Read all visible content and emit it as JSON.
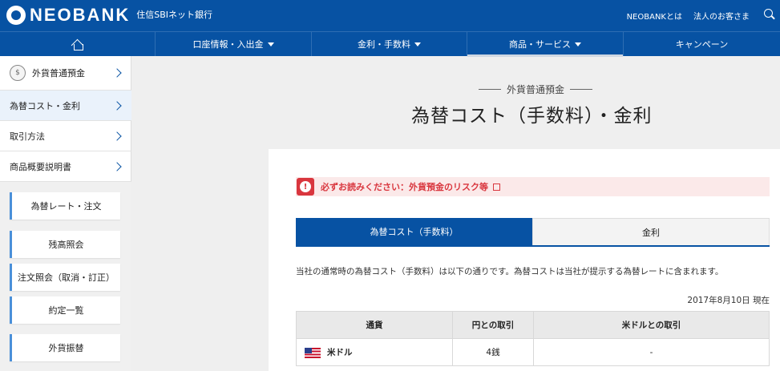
{
  "header": {
    "logo": "NEOBANK",
    "logo_sub": "住信SBIネット銀行",
    "links": [
      "NEOBANKとは",
      "法人のお客さま"
    ]
  },
  "nav": {
    "items": [
      {
        "label": "",
        "icon": "home-icon"
      },
      {
        "label": "口座情報・入出金",
        "dropdown": true
      },
      {
        "label": "金利・手数料",
        "dropdown": true
      },
      {
        "label": "商品・サービス",
        "dropdown": true,
        "active": true
      },
      {
        "label": "キャンペーン",
        "dropdown": false
      }
    ]
  },
  "sidebar": {
    "top": "外貨普通預金",
    "items": [
      "為替コスト・金利",
      "取引方法",
      "商品概要説明書"
    ],
    "sub_buttons": [
      "為替レート・注文",
      "残高照会",
      "注文照会（取消・訂正）",
      "約定一覧",
      "外貨振替"
    ]
  },
  "main": {
    "subtitle": "外貨普通預金",
    "title": "為替コスト（手数料）・金利",
    "warning": "必ずお読みください：外貨預金のリスク等",
    "tabs": [
      "為替コスト（手数料）",
      "金利"
    ],
    "description": "当社の通常時の為替コスト（手数料）は以下の通りです。為替コストは当社が提示する為替レートに含まれます。",
    "as_of": "2017年8月10日 現在",
    "table": {
      "headers": [
        "通貨",
        "円との取引",
        "米ドルとの取引"
      ],
      "rows": [
        {
          "currency": "米ドル",
          "jpy": "4銭",
          "usd": "-"
        }
      ]
    }
  }
}
